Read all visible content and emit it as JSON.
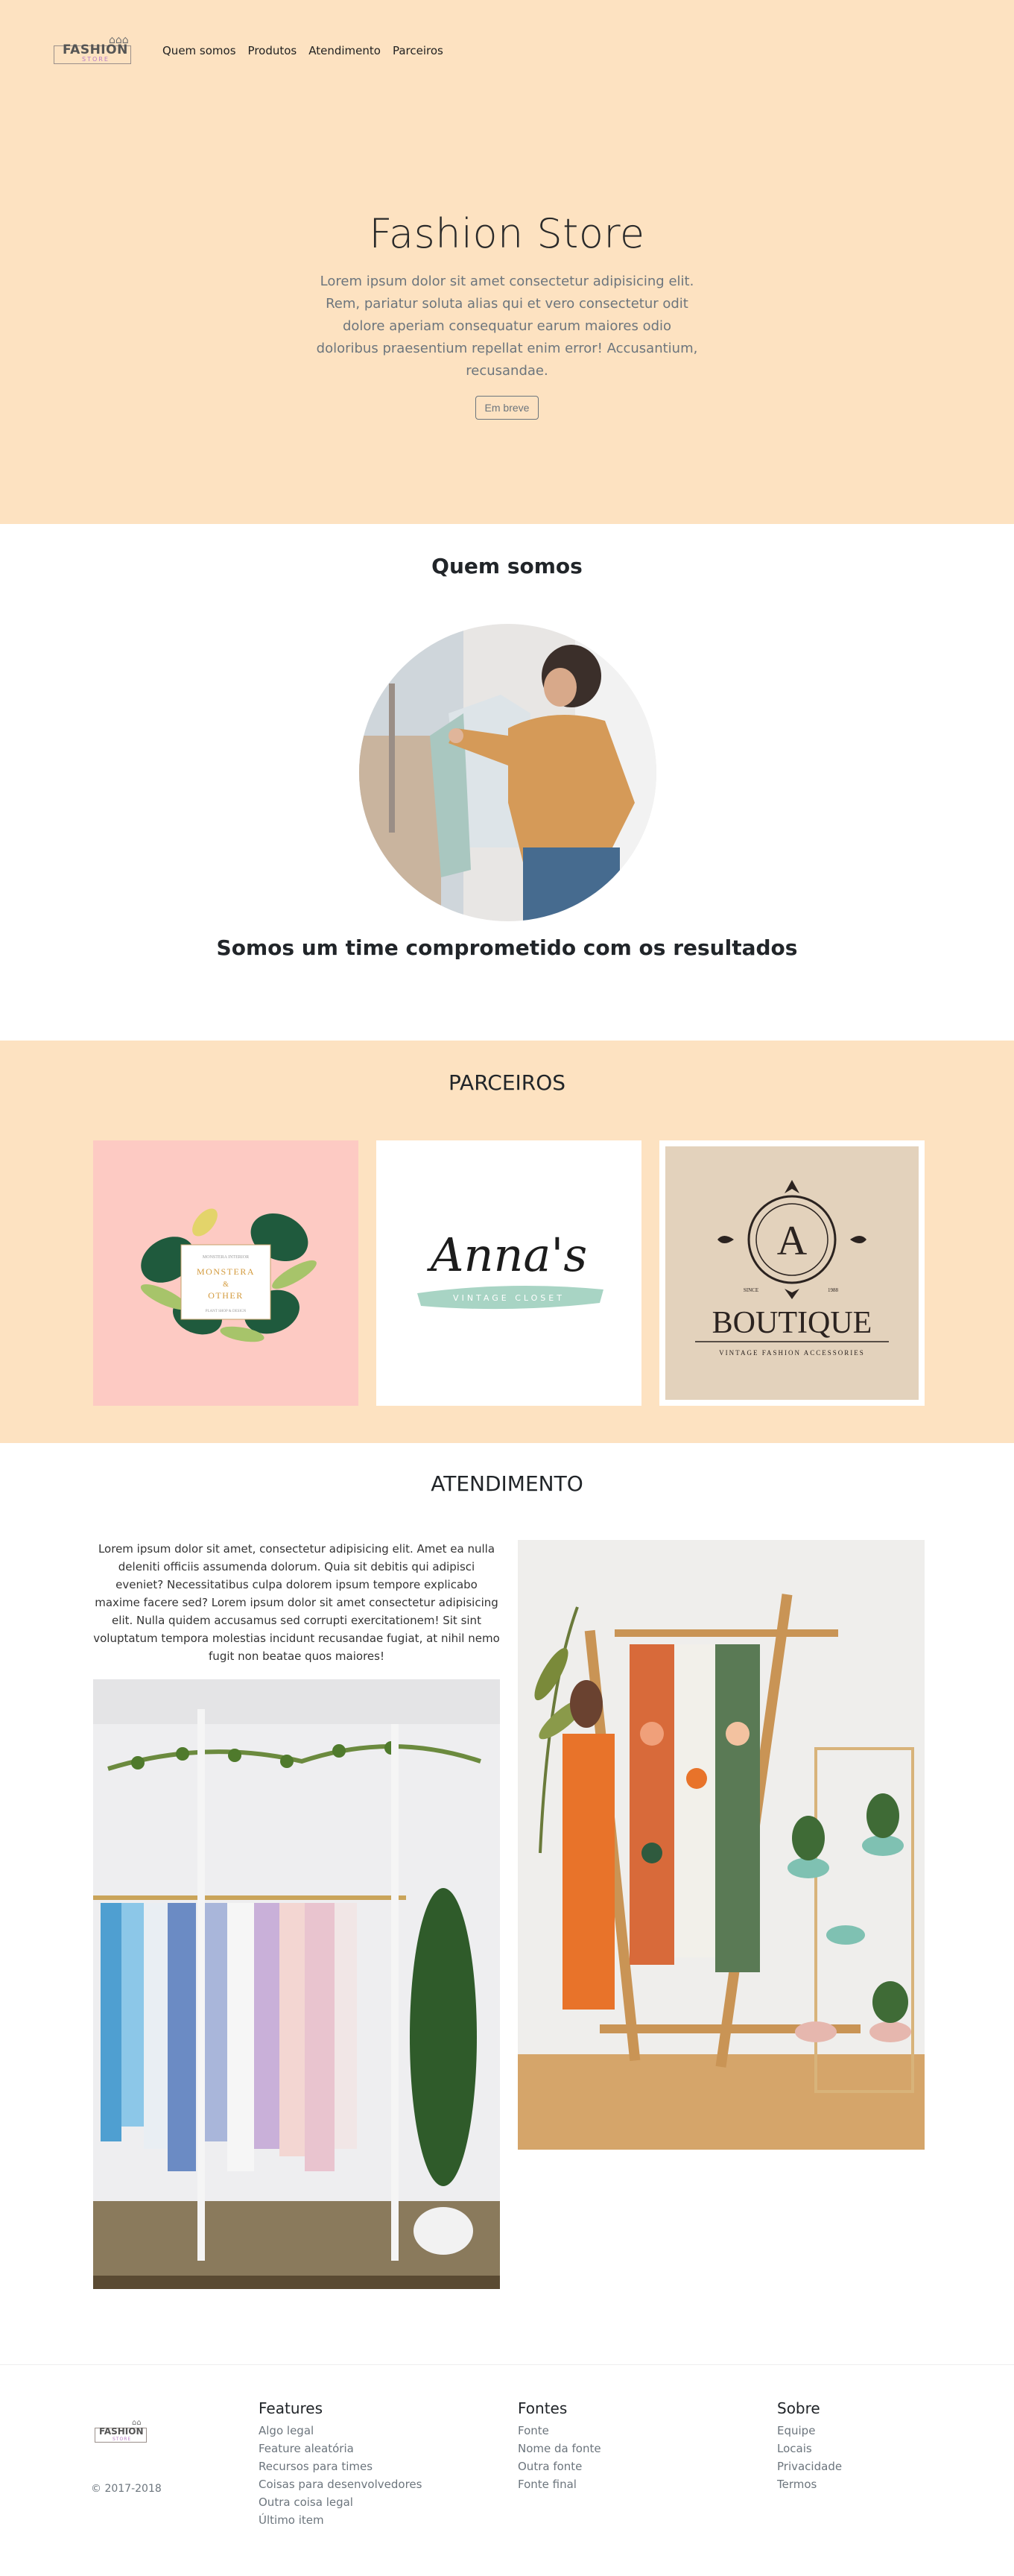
{
  "nav": {
    "logo_word": "FASHION",
    "logo_sub": "STORE",
    "links": [
      "Quem somos",
      "Produtos",
      "Atendimento",
      "Parceiros"
    ]
  },
  "hero": {
    "title": "Fashion Store",
    "text": "Lorem ipsum dolor sit amet consectetur adipisicing elit. Rem, pariatur soluta alias qui et vero consectetur odit dolore aperiam consequatur earum maiores odio doloribus praesentium repellat enim error! Accusantium, recusandae.",
    "button": "Em breve"
  },
  "about": {
    "title": "Quem somos",
    "tagline": "Somos um time comprometido com os resultados"
  },
  "partners": {
    "title": "PARCEIROS",
    "monstera": {
      "top": "MONSTERA INTERIOR",
      "line1": "MONSTERA",
      "amp": "&",
      "line2": "OTHER",
      "bottom": "PLANT SHOP & DESIGN"
    },
    "annas": {
      "name": "Anna's",
      "sub": "VINTAGE CLOSET"
    },
    "boutique": {
      "letter": "A",
      "since": "SINCE",
      "year": "1988",
      "name": "BOUTIQUE",
      "sub": "VINTAGE FASHION ACCESSORIES"
    }
  },
  "service": {
    "title": "ATENDIMENTO",
    "text": "Lorem ipsum dolor sit amet, consectetur adipisicing elit. Amet ea nulla deleniti officiis assumenda dolorum. Quia sit debitis qui adipisci eveniet? Necessitatibus culpa dolorem ipsum tempore explicabo maxime facere sed? Lorem ipsum dolor sit amet consectetur adipisicing elit. Nulla quidem accusamus sed corrupti exercitationem! Sit sint voluptatum tempora molestias incidunt recusandae fugiat, at nihil nemo fugit non beatae quos maiores!"
  },
  "footer": {
    "copyright": "© 2017-2018",
    "columns": [
      {
        "title": "Features",
        "items": [
          "Algo legal",
          "Feature aleatória",
          "Recursos para times",
          "Coisas para desenvolvedores",
          "Outra coisa legal",
          "Último item"
        ]
      },
      {
        "title": "Fontes",
        "items": [
          "Fonte",
          "Nome da fonte",
          "Outra fonte",
          "Fonte final"
        ]
      },
      {
        "title": "Sobre",
        "items": [
          "Equipe",
          "Locais",
          "Privacidade",
          "Termos"
        ]
      }
    ]
  }
}
